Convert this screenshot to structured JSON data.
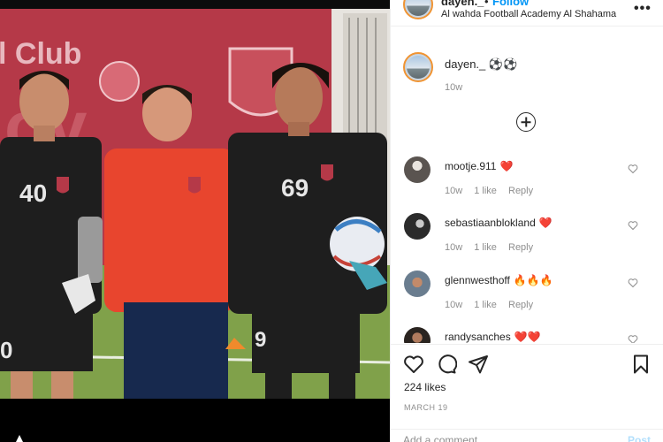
{
  "header": {
    "username": "dayen._",
    "separator": "•",
    "follow_label": "Follow",
    "location": "Al wahda Football Academy Al Shahama",
    "more_label": "•••"
  },
  "caption": {
    "username": "dayen._",
    "text": "⚽⚽",
    "time": "10w"
  },
  "comments": [
    {
      "username": "mootje.911",
      "emoji": "❤️",
      "time": "10w",
      "likes": "1 like",
      "reply": "Reply"
    },
    {
      "username": "sebastiaanblokland",
      "emoji": "❤️",
      "time": "10w",
      "likes": "1 like",
      "reply": "Reply"
    },
    {
      "username": "glennwesthoff",
      "emoji": "🔥🔥🔥",
      "time": "10w",
      "likes": "1 like",
      "reply": "Reply"
    },
    {
      "username": "randysanches",
      "emoji": "❤️❤️",
      "time": "",
      "likes": "",
      "reply": ""
    }
  ],
  "post": {
    "likes": "224 likes",
    "date": "MARCH 19",
    "comment_placeholder": "Add a comment…",
    "post_label": "Post"
  },
  "photo": {
    "banner_text": "l Club",
    "jersey_left": "40",
    "jersey_right": "69",
    "shorts_left": "0",
    "shorts_right": "9"
  }
}
